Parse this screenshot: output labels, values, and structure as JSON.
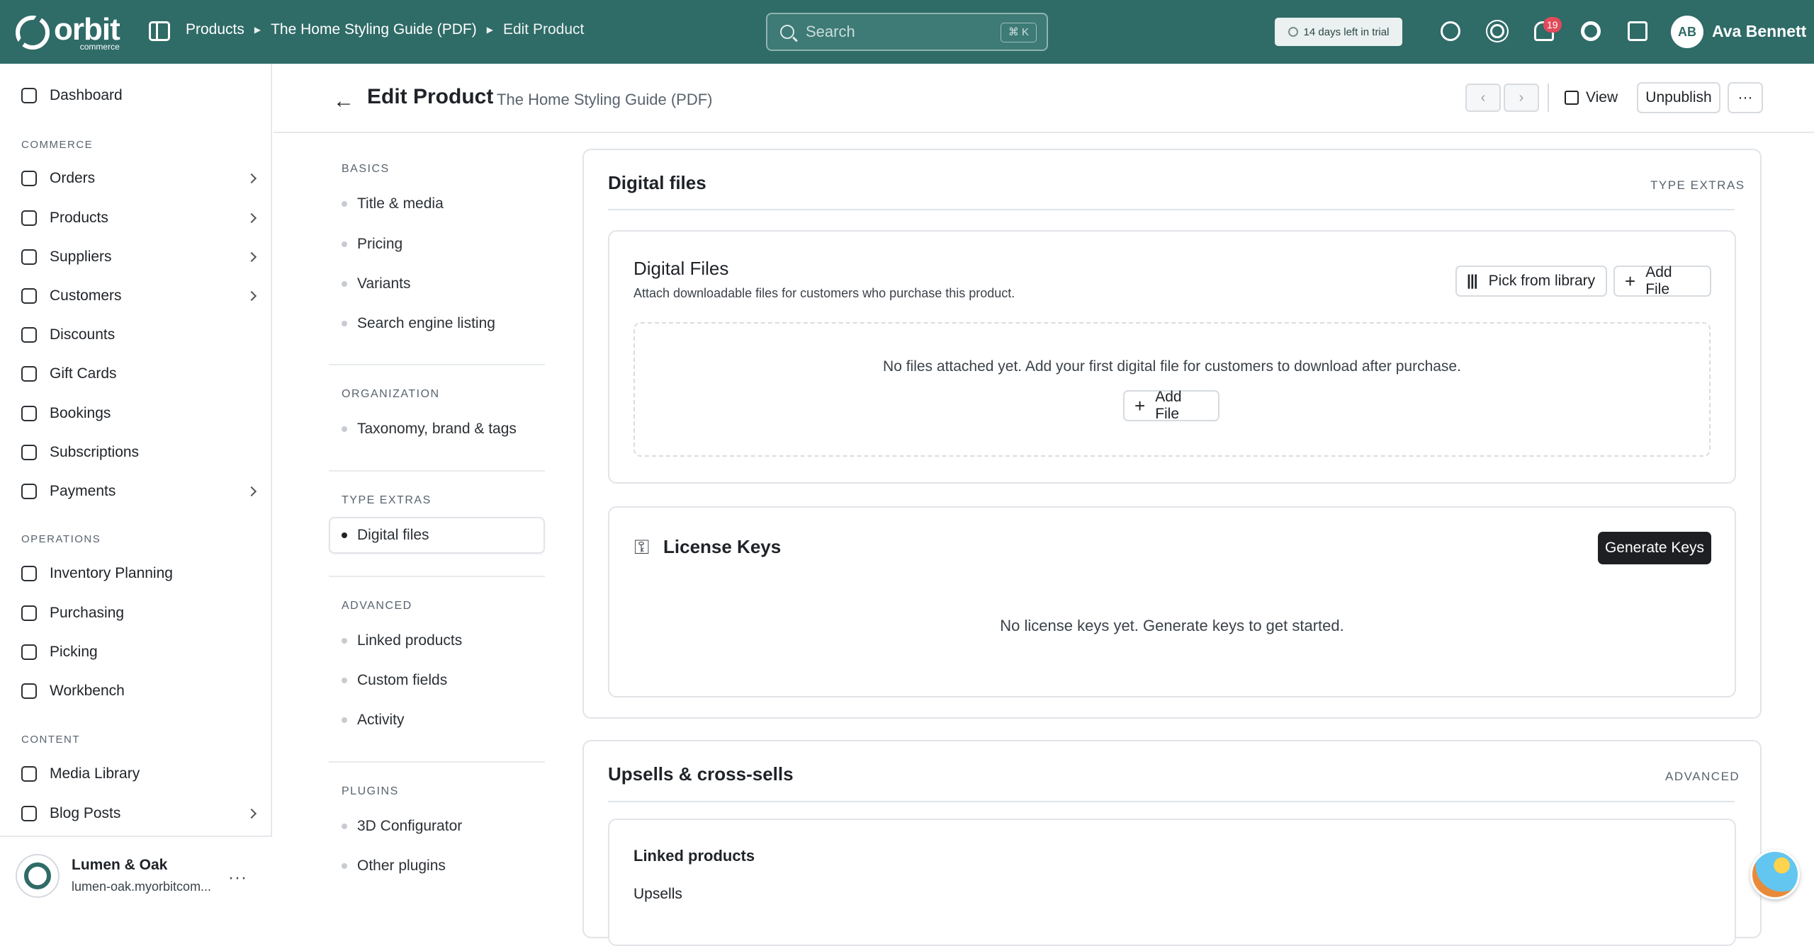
{
  "brand": {
    "wordmark": "orbit",
    "sub": "commerce"
  },
  "breadcrumb": [
    "Products",
    "The Home Styling Guide (PDF)",
    "Edit Product"
  ],
  "search": {
    "placeholder": "Search",
    "shortcut": "⌘ K"
  },
  "trial": "14 days left in trial",
  "notifications_count": "19",
  "user": {
    "initials": "AB",
    "name": "Ava Bennett"
  },
  "sidebar": {
    "dashboard": "Dashboard",
    "commerce_title": "COMMERCE",
    "commerce": [
      "Orders",
      "Products",
      "Suppliers",
      "Customers",
      "Discounts",
      "Gift Cards",
      "Bookings",
      "Subscriptions",
      "Payments"
    ],
    "operations_title": "OPERATIONS",
    "operations": [
      "Inventory Planning",
      "Purchasing",
      "Picking",
      "Workbench"
    ],
    "content_title": "CONTENT",
    "content": [
      "Media Library",
      "Blog Posts"
    ],
    "store": {
      "name": "Lumen & Oak",
      "url": "lumen-oak.myorbitcom..."
    }
  },
  "page": {
    "title": "Edit Product",
    "subtitle": "· The Home Styling Guide (PDF)",
    "view": "View",
    "unpublish": "Unpublish",
    "prev": "‹",
    "next": "›",
    "more": "···"
  },
  "index": {
    "basics_title": "BASICS",
    "basics": [
      "Title & media",
      "Pricing",
      "Variants",
      "Search engine listing"
    ],
    "organization_title": "ORGANIZATION",
    "organization": [
      "Taxonomy, brand & tags"
    ],
    "type_extras_title": "TYPE EXTRAS",
    "type_extras": [
      "Digital files"
    ],
    "advanced_title": "ADVANCED",
    "advanced": [
      "Linked products",
      "Custom fields",
      "Activity"
    ],
    "plugins_title": "PLUGINS",
    "plugins": [
      "3D Configurator",
      "Other plugins"
    ]
  },
  "digital_section": {
    "title": "Digital files",
    "tag": "TYPE EXTRAS",
    "files_title": "Digital Files",
    "files_desc": "Attach downloadable files for customers who purchase this product.",
    "pick_library": "Pick from library",
    "add_file": "Add File",
    "empty_text": "No files attached yet. Add your first digital file for customers to download after purchase.",
    "empty_add": "Add File",
    "license_title": "License Keys",
    "generate": "Generate Keys",
    "license_empty": "No license keys yet. Generate keys to get started."
  },
  "upsells_section": {
    "title": "Upsells & cross-sells",
    "tag": "ADVANCED",
    "linked_title": "Linked products",
    "upsells_label": "Upsells"
  }
}
